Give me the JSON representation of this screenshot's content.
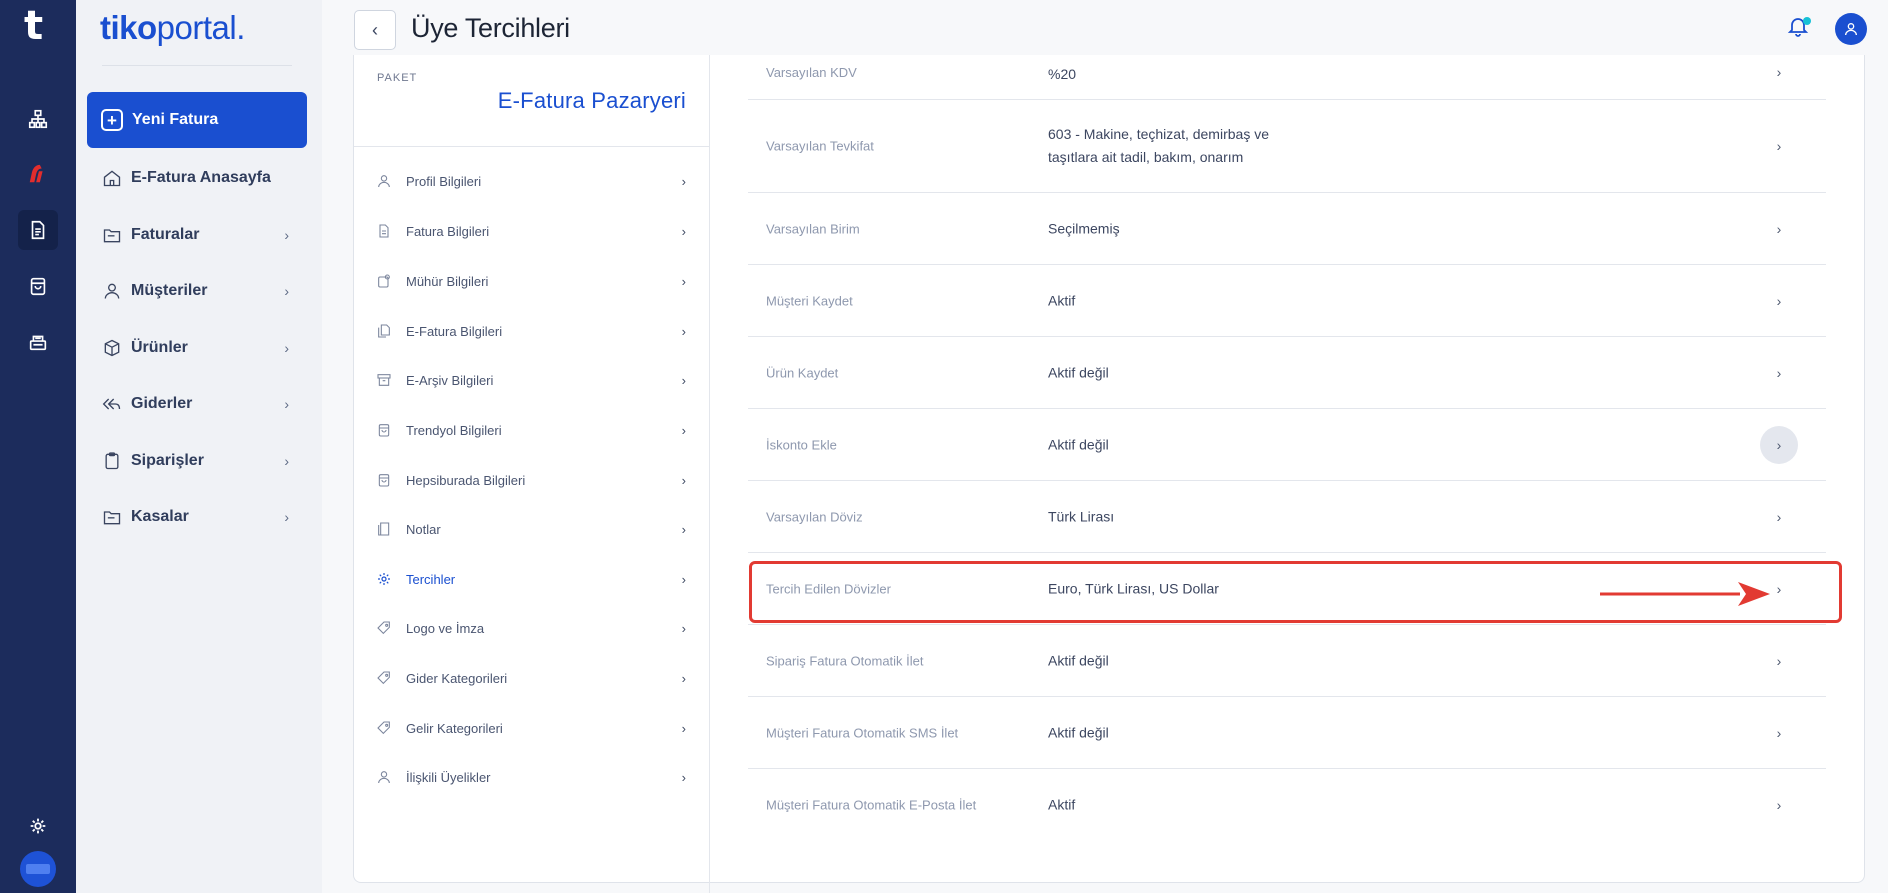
{
  "brand": {
    "part1": "tiko",
    "part2": "portal",
    "dot": "."
  },
  "rail": {
    "logo": "t"
  },
  "nav": {
    "new_invoice": "Yeni Fatura",
    "items": [
      {
        "label": "E-Fatura Anasayfa",
        "icon": "home-icon",
        "has_arrow": false
      },
      {
        "label": "Faturalar",
        "icon": "folder-icon",
        "has_arrow": true
      },
      {
        "label": "Müşteriler",
        "icon": "user-icon",
        "has_arrow": true
      },
      {
        "label": "Ürünler",
        "icon": "box-icon",
        "has_arrow": true
      },
      {
        "label": "Giderler",
        "icon": "reply-all-icon",
        "has_arrow": true
      },
      {
        "label": "Siparişler",
        "icon": "clipboard-icon",
        "has_arrow": true
      },
      {
        "label": "Kasalar",
        "icon": "folder-icon",
        "has_arrow": true
      }
    ],
    "chevron": "›"
  },
  "header": {
    "title": "Üye Tercihleri",
    "back": "‹"
  },
  "package": {
    "label": "PAKET",
    "name": "E-Fatura Pazaryeri"
  },
  "menu": [
    {
      "label": "Profil Bilgileri",
      "icon": "user-icon"
    },
    {
      "label": "Fatura Bilgileri",
      "icon": "document-icon"
    },
    {
      "label": "Mühür Bilgileri",
      "icon": "seal-icon"
    },
    {
      "label": "E-Fatura Bilgileri",
      "icon": "documents-icon"
    },
    {
      "label": "E-Arşiv Bilgileri",
      "icon": "archive-icon"
    },
    {
      "label": "Trendyol Bilgileri",
      "icon": "bag-icon"
    },
    {
      "label": "Hepsiburada Bilgileri",
      "icon": "bag-icon"
    },
    {
      "label": "Notlar",
      "icon": "note-icon"
    },
    {
      "label": "Tercihler",
      "icon": "gear-icon",
      "active": true
    },
    {
      "label": "Logo ve İmza",
      "icon": "tag-icon"
    },
    {
      "label": "Gider Kategorileri",
      "icon": "tag-icon"
    },
    {
      "label": "Gelir Kategorileri",
      "icon": "tag-icon"
    },
    {
      "label": "İlişkili Üyelikler",
      "icon": "user-icon"
    }
  ],
  "settings": [
    {
      "label": "Varsayılan KDV",
      "value": "%20"
    },
    {
      "label": "Varsayılan Tevkifat",
      "value": "603 - Makine, teçhizat, demirbaş ve taşıtlara ait tadil, bakım, onarım"
    },
    {
      "label": "Varsayılan Birim",
      "value": "Seçilmemiş"
    },
    {
      "label": "Müşteri Kaydet",
      "value": "Aktif"
    },
    {
      "label": "Ürün Kaydet",
      "value": "Aktif değil"
    },
    {
      "label": "İskonto Ekle",
      "value": "Aktif değil"
    },
    {
      "label": "Varsayılan Döviz",
      "value": "Türk Lirası"
    },
    {
      "label": "Tercih Edilen Dövizler",
      "value": "Euro, Türk Lirası, US Dollar"
    },
    {
      "label": "Sipariş Fatura Otomatik İlet",
      "value": "Aktif değil"
    },
    {
      "label": "Müşteri Fatura Otomatik SMS İlet",
      "value": "Aktif değil"
    },
    {
      "label": "Müşteri Fatura Otomatik E-Posta İlet",
      "value": "Aktif"
    }
  ],
  "colors": {
    "primary": "#1a4fd0",
    "rail": "#1c2c5c",
    "highlight": "#e23a32",
    "notification": "#16c1d6"
  }
}
